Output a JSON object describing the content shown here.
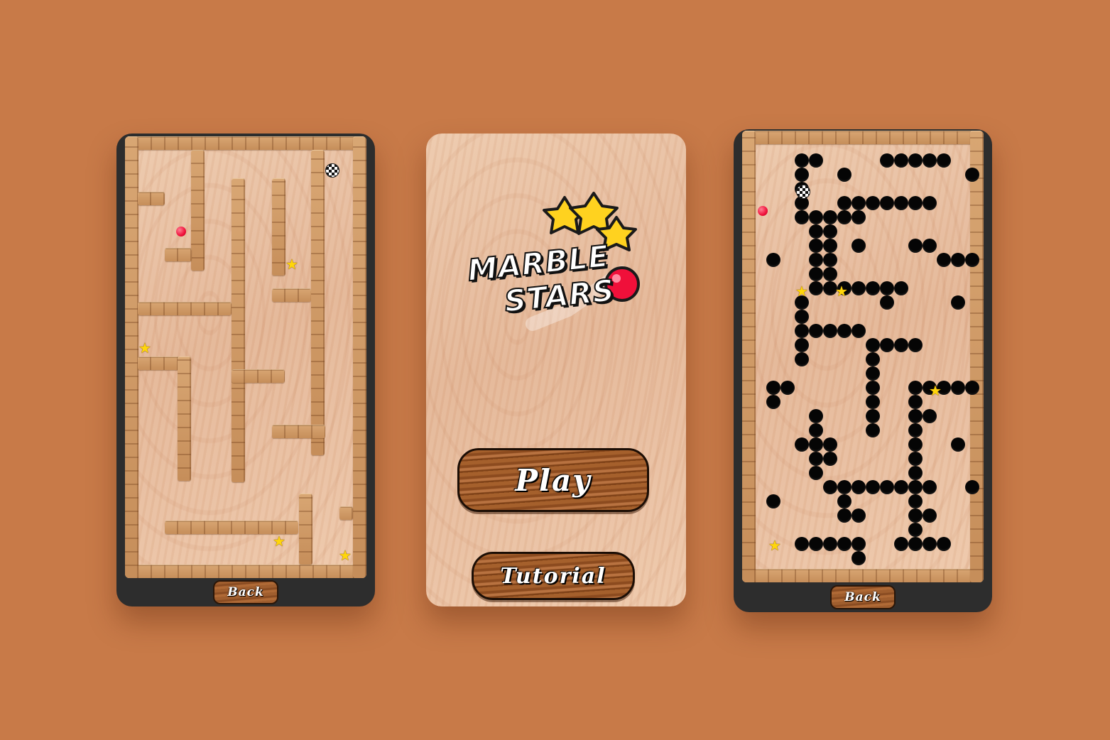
{
  "screens": {
    "left": {
      "back_label": "Back"
    },
    "menu": {
      "logo_line1": "MARBLE",
      "logo_line2": "STARS",
      "play_label": "Play",
      "tutorial_label": "Tutorial"
    },
    "right": {
      "back_label": "Back"
    }
  },
  "colors": {
    "background": "#c87a48",
    "marble": "#f0103a",
    "star": "#ffd60a",
    "hole": "#050505",
    "phone_frame": "#2d2d2d"
  },
  "icons": {
    "star": "star-icon",
    "goal": "checkered-flag-icon",
    "marble": "marble-icon"
  }
}
